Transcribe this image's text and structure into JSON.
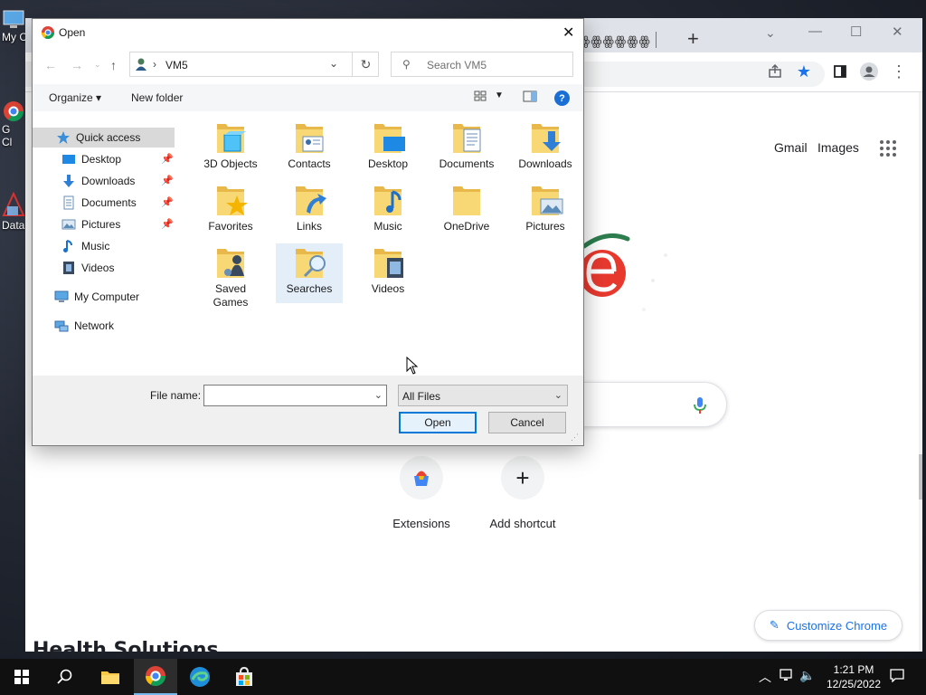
{
  "desktop": {
    "icons": [
      {
        "label": "My C"
      },
      {
        "label": "G"
      },
      {
        "label": "Cl"
      },
      {
        "label": "Data"
      }
    ]
  },
  "chrome": {
    "tab_glyphs": "ꙮꙮꙮꙮꙮꙮ",
    "links": {
      "gmail": "Gmail",
      "images": "Images"
    },
    "shortcuts": [
      {
        "label": "Extensions"
      },
      {
        "label": "Add shortcut"
      }
    ],
    "customize_label": "Customize Chrome",
    "page_text_fragment": "Health Solutions"
  },
  "dialog": {
    "title": "Open",
    "breadcrumb": "VM5",
    "search_placeholder": "Search VM5",
    "organize_label": "Organize ▾",
    "new_folder_label": "New folder",
    "help_label": "?",
    "nav": [
      {
        "label": "Quick access",
        "selected": true
      },
      {
        "label": "Desktop",
        "pinned": true
      },
      {
        "label": "Downloads",
        "pinned": true
      },
      {
        "label": "Documents",
        "pinned": true
      },
      {
        "label": "Pictures",
        "pinned": true
      },
      {
        "label": "Music"
      },
      {
        "label": "Videos"
      },
      {
        "label": "My Computer"
      },
      {
        "label": "Network"
      }
    ],
    "files": [
      {
        "name": "3D Objects"
      },
      {
        "name": "Contacts"
      },
      {
        "name": "Desktop"
      },
      {
        "name": "Documents"
      },
      {
        "name": "Downloads"
      },
      {
        "name": "Favorites"
      },
      {
        "name": "Links"
      },
      {
        "name": "Music"
      },
      {
        "name": "OneDrive"
      },
      {
        "name": "Pictures"
      },
      {
        "name": "Saved\nGames"
      },
      {
        "name": "Searches",
        "selected": true
      },
      {
        "name": "Videos"
      }
    ],
    "file_name_label": "File name:",
    "file_name_value": "",
    "file_type": "All Files",
    "open_label": "Open",
    "cancel_label": "Cancel"
  },
  "taskbar": {
    "time": "1:21 PM",
    "date": "12/25/2022"
  },
  "colors": {
    "accent": "#0078d7",
    "chrome_blue": "#1a73e8",
    "folder_yellow": "#f8d775"
  }
}
